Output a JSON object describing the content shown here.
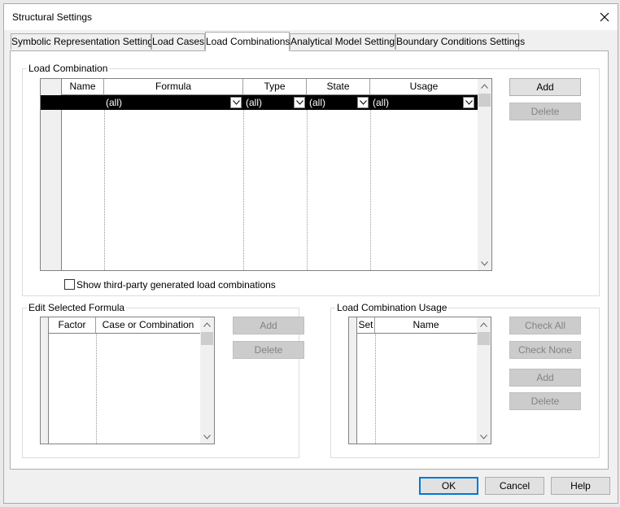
{
  "window": {
    "title": "Structural Settings"
  },
  "tabs": [
    {
      "label": "Symbolic Representation Settings"
    },
    {
      "label": "Load Cases"
    },
    {
      "label": "Load Combinations"
    },
    {
      "label": "Analytical Model Settings"
    },
    {
      "label": "Boundary Conditions Settings"
    }
  ],
  "load_combination": {
    "group_label": "Load Combination",
    "columns": [
      "Name",
      "Formula",
      "Type",
      "State",
      "Usage"
    ],
    "filter_row": {
      "formula": "(all)",
      "type": "(all)",
      "state": "(all)",
      "usage": "(all)"
    },
    "add_label": "Add",
    "delete_label": "Delete",
    "show_third_party_label": "Show third-party generated load combinations"
  },
  "edit_formula": {
    "group_label": "Edit Selected Formula",
    "columns": [
      "Factor",
      "Case or Combination"
    ],
    "add_label": "Add",
    "delete_label": "Delete"
  },
  "usage": {
    "group_label": "Load Combination Usage",
    "columns": [
      "Set",
      "Name"
    ],
    "check_all_label": "Check All",
    "check_none_label": "Check None",
    "add_label": "Add",
    "delete_label": "Delete"
  },
  "footer": {
    "ok_label": "OK",
    "cancel_label": "Cancel",
    "help_label": "Help"
  }
}
